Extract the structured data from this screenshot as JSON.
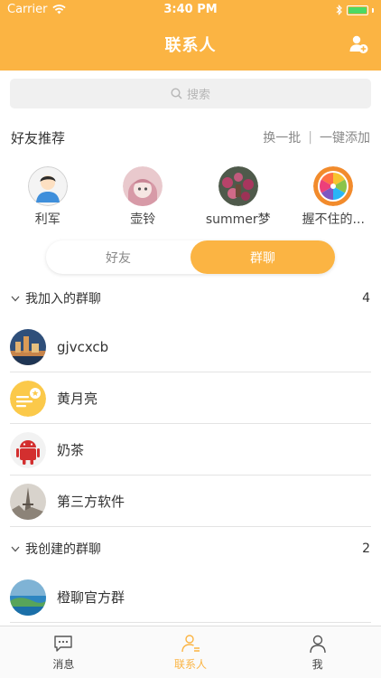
{
  "status_bar": {
    "carrier": "Carrier",
    "time": "3:40 PM"
  },
  "nav": {
    "title": "联系人",
    "right_icon": "add-contact-icon"
  },
  "search": {
    "placeholder": "搜索"
  },
  "recommend": {
    "title": "好友推荐",
    "refresh_label": "换一批",
    "divider": "|",
    "add_all_label": "一键添加",
    "items": [
      {
        "name": "利军",
        "avatar": "cartoon-boy-avatar"
      },
      {
        "name": "壶铃",
        "avatar": "anime-girl-avatar"
      },
      {
        "name": "summer梦",
        "avatar": "flowers-photo-avatar"
      },
      {
        "name": "握不住的...",
        "avatar": "orange-slice-avatar"
      }
    ]
  },
  "segments": {
    "friends": "好友",
    "groups": "群聊",
    "active": "群聊"
  },
  "joined_groups": {
    "title": "我加入的群聊",
    "count": "4",
    "items": [
      {
        "name": "gjvcxcb",
        "avatar": "city-photo-avatar"
      },
      {
        "name": "黄月亮",
        "avatar": "yellow-moon-avatar"
      },
      {
        "name": "奶茶",
        "avatar": "android-robot-avatar"
      },
      {
        "name": "第三方软件",
        "avatar": "paris-photo-avatar"
      }
    ]
  },
  "created_groups": {
    "title": "我创建的群聊",
    "count": "2",
    "items": [
      {
        "name": "橙聊官方群",
        "avatar": "coast-photo-avatar"
      }
    ]
  },
  "tabbar": {
    "items": [
      {
        "label": "消息",
        "icon": "message-icon"
      },
      {
        "label": "联系人",
        "icon": "contacts-icon"
      },
      {
        "label": "我",
        "icon": "profile-icon"
      }
    ],
    "active": "联系人"
  },
  "colors": {
    "accent": "#fbb443",
    "separator": "#e3e3e3",
    "search_bg": "#f0f0f0",
    "battery": "#4cd964"
  }
}
